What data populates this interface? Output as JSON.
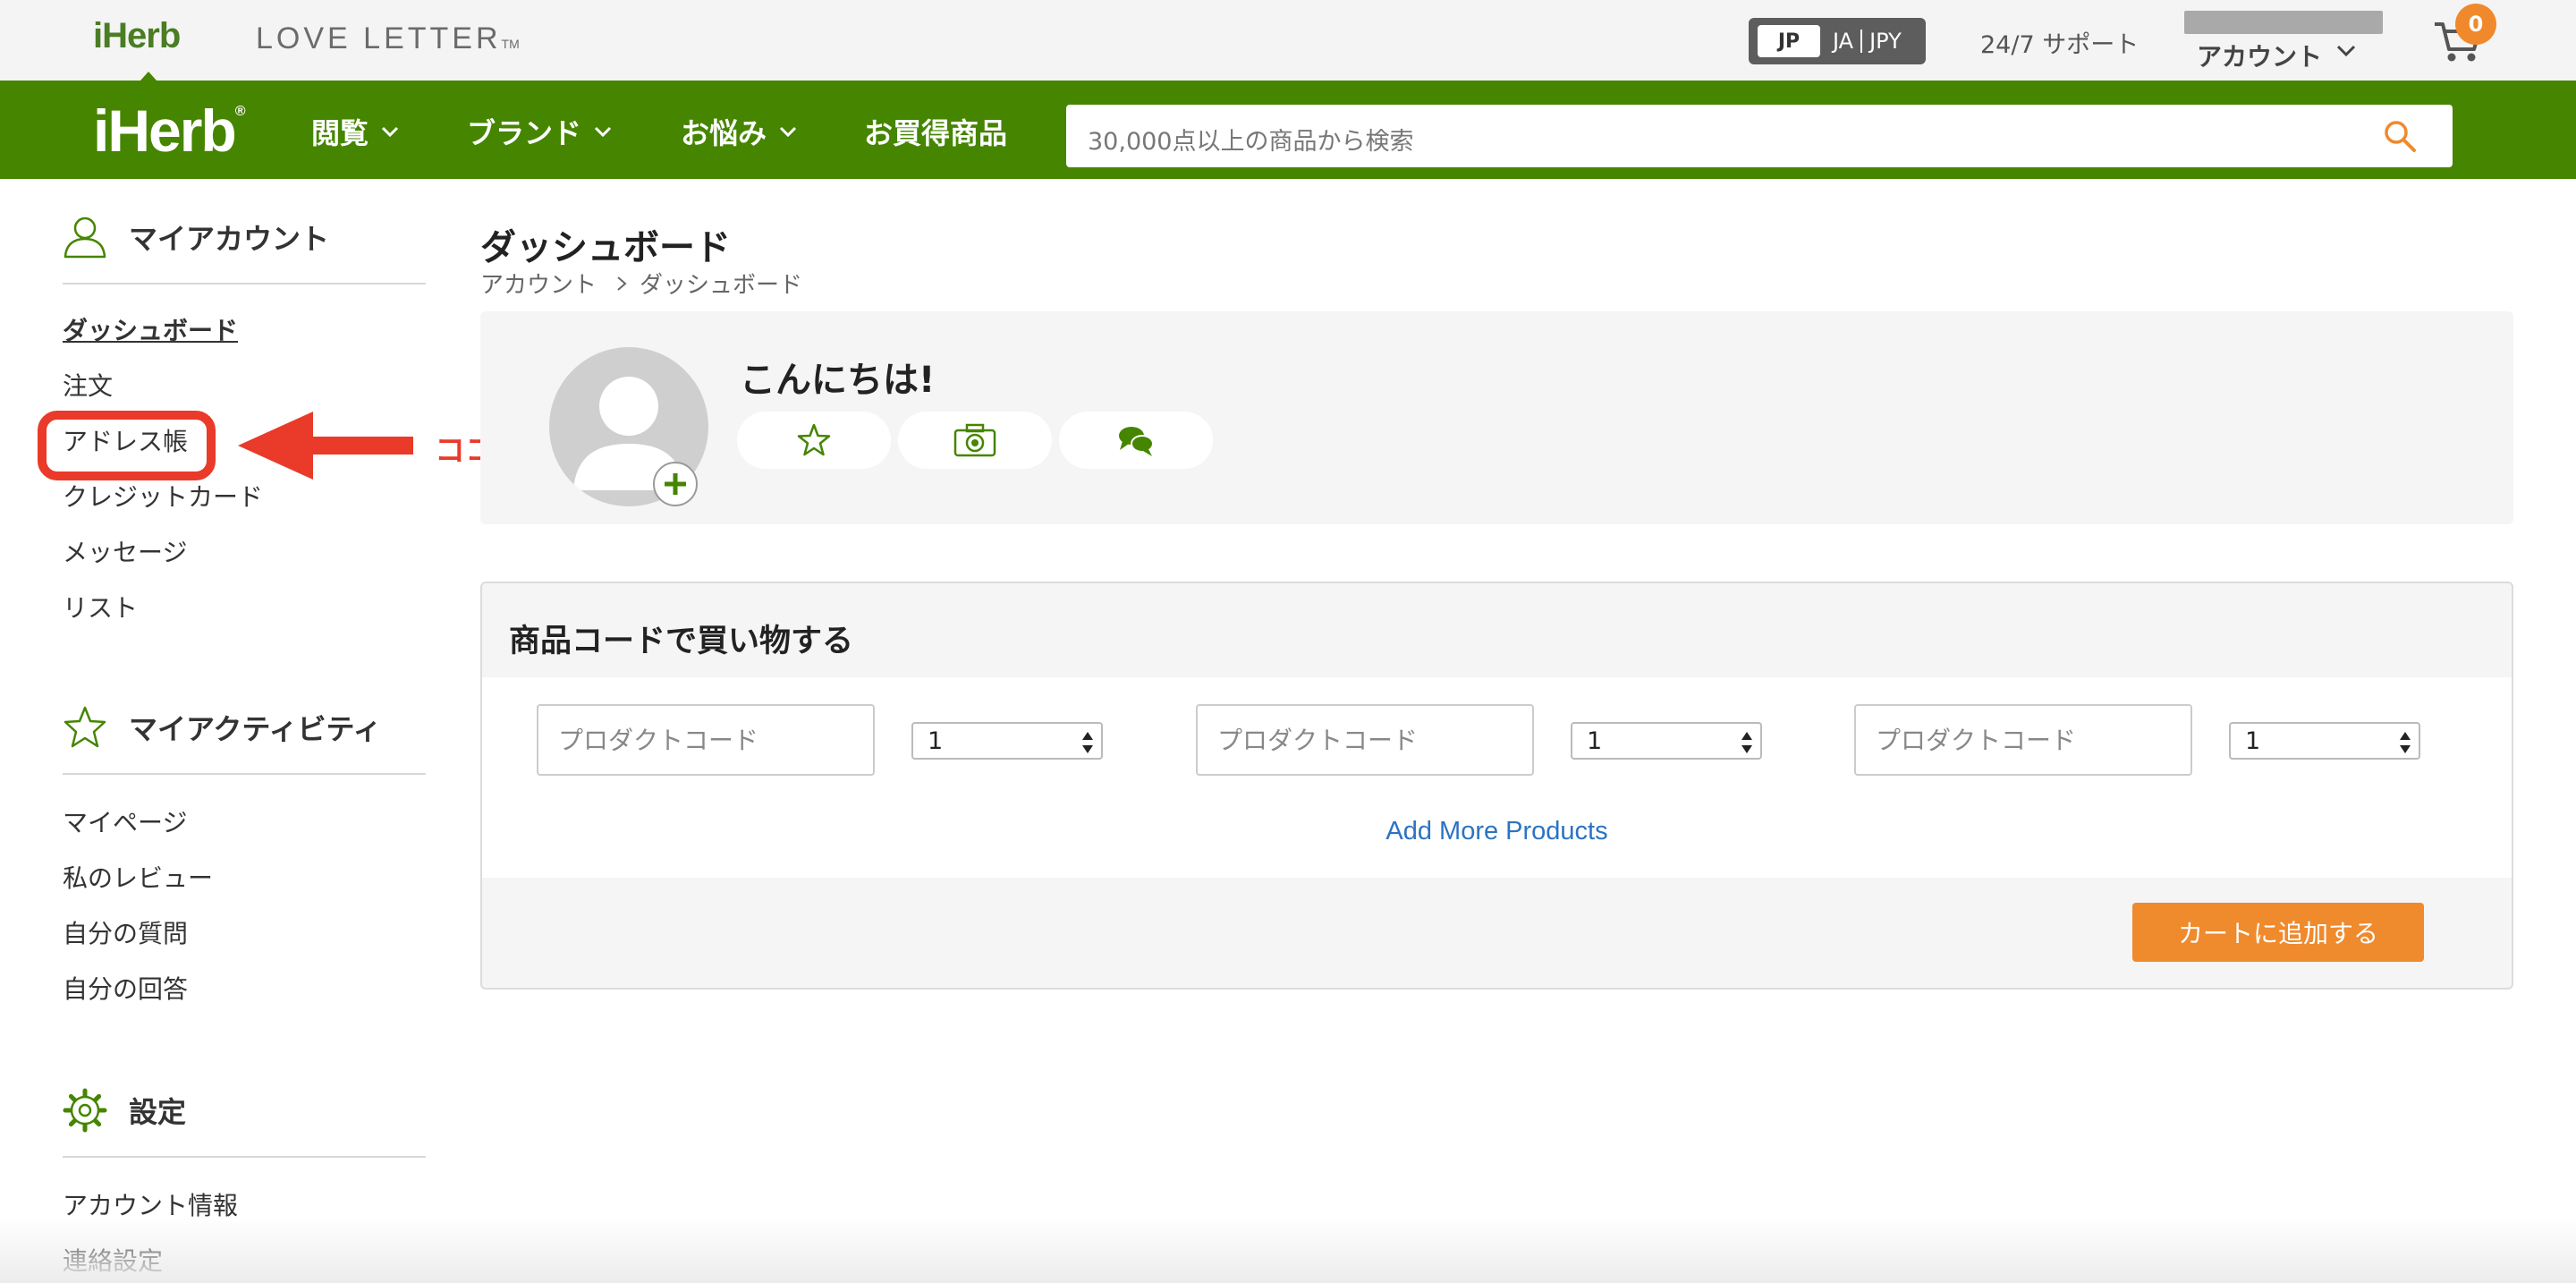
{
  "topbar": {
    "brand": "iHerb",
    "love_letter": "LOVE LETTER",
    "love_letter_tm": "TM",
    "locale": {
      "country": "JP",
      "language": "JA",
      "currency": "JPY"
    },
    "support": "24/7 サポート",
    "account": "アカウント",
    "cart_count": "0"
  },
  "navbar": {
    "logo": "iHerb",
    "logo_mark": "®",
    "items": [
      {
        "label": "閲覧",
        "has_dropdown": true
      },
      {
        "label": "ブランド",
        "has_dropdown": true
      },
      {
        "label": "お悩み",
        "has_dropdown": true
      },
      {
        "label": "お買得商品",
        "has_dropdown": false
      }
    ],
    "search_placeholder": "30,000点以上の商品から検索"
  },
  "sidebar": {
    "sections": [
      {
        "title": "マイアカウント",
        "icon": "user-icon",
        "items": [
          "ダッシュボード",
          "注文",
          "アドレス帳",
          "クレジットカード",
          "メッセージ",
          "リスト"
        ]
      },
      {
        "title": "マイアクティビティ",
        "icon": "star-outline-icon",
        "items": [
          "マイページ",
          "私のレビュー",
          "自分の質問",
          "自分の回答"
        ]
      },
      {
        "title": "設定",
        "icon": "gear-icon",
        "items": [
          "アカウント情報",
          "連絡設定"
        ]
      }
    ],
    "active_item": "ダッシュボード"
  },
  "annotation": {
    "label": "ココ",
    "color": "#e93a2a"
  },
  "main": {
    "title": "ダッシュボード",
    "breadcrumb": [
      "アカウント",
      "ダッシュボード"
    ],
    "greeting": "こんにちは!",
    "quick_actions": [
      "star-icon",
      "camera-icon",
      "chat-icon"
    ],
    "order_by_code": {
      "title": "商品コードで買い物する",
      "rows": [
        {
          "placeholder": "プロダクトコード",
          "qty": "1"
        },
        {
          "placeholder": "プロダクトコード",
          "qty": "1"
        },
        {
          "placeholder": "プロダクトコード",
          "qty": "1"
        }
      ],
      "add_more": "Add More Products",
      "add_to_cart": "カートに追加する"
    }
  },
  "colors": {
    "brand_green": "#458500",
    "accent_orange": "#ef8a2d",
    "link_blue": "#2b73c3"
  }
}
